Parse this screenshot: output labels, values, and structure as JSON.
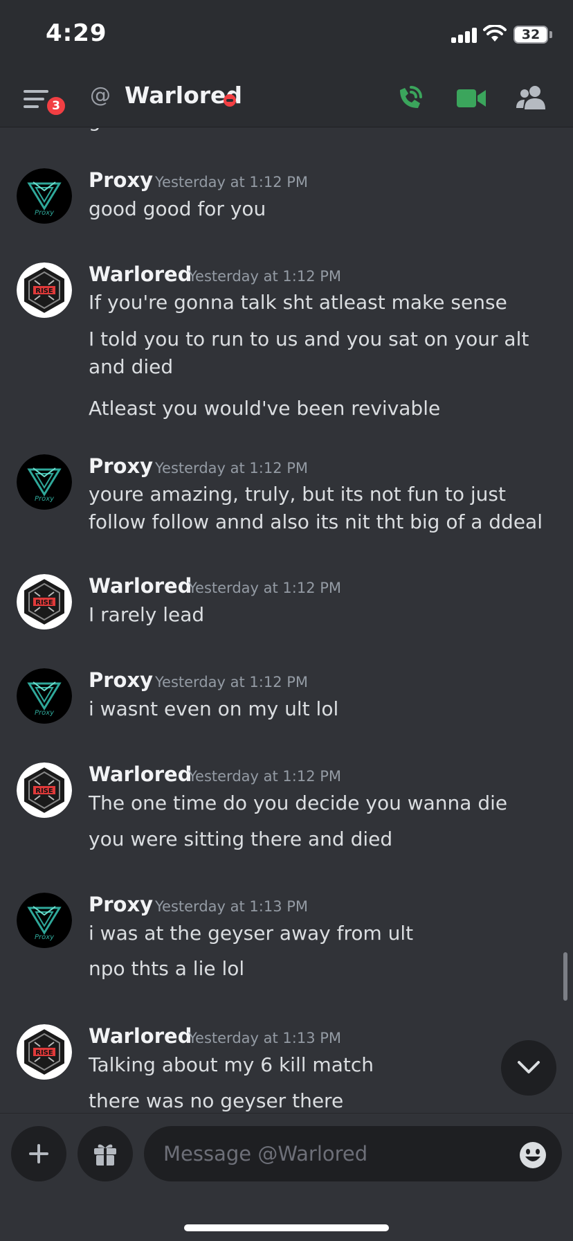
{
  "status_bar": {
    "time": "4:29",
    "battery": "32"
  },
  "header": {
    "unread_badge": "3",
    "at_symbol": "@",
    "channel_name": "Warlored"
  },
  "avatars": {
    "proxy_text": "Proxy",
    "warlored_text": "RISE"
  },
  "messages": [
    {
      "author": "Proxy",
      "timestamp": "Yesterday at 1:12 PM",
      "avatar": "proxy",
      "lines": [
        "good good for you"
      ]
    },
    {
      "author": "Warlored",
      "timestamp": "Yesterday at 1:12 PM",
      "avatar": "warlored",
      "lines": [
        "If you're gonna talk sht atleast make sense",
        "I told you to run to us and you sat on your alt and died",
        "Atleast you would've been revivable"
      ]
    },
    {
      "author": "Proxy",
      "timestamp": "Yesterday at 1:12 PM",
      "avatar": "proxy",
      "lines": [
        "youre amazing, truly, but its not fun to just follow follow annd also its nit tht big of a ddeal"
      ]
    },
    {
      "author": "Warlored",
      "timestamp": "Yesterday at 1:12 PM",
      "avatar": "warlored",
      "lines": [
        "I rarely lead"
      ]
    },
    {
      "author": "Proxy",
      "timestamp": "Yesterday at 1:12 PM",
      "avatar": "proxy",
      "lines": [
        "i wasnt even on my ult lol"
      ]
    },
    {
      "author": "Warlored",
      "timestamp": "Yesterday at 1:12 PM",
      "avatar": "warlored",
      "lines": [
        "The one time do you decide you wanna die",
        "you were sitting there and died"
      ]
    },
    {
      "author": "Proxy",
      "timestamp": "Yesterday at 1:13 PM",
      "avatar": "proxy",
      "lines": [
        "i was at the geyser away from ult",
        "npo thts a lie lol"
      ]
    },
    {
      "author": "Warlored",
      "timestamp": "Yesterday at 1:13 PM",
      "avatar": "warlored",
      "lines": [
        "Talking about my 6 kill match",
        "there was no geyser there"
      ]
    }
  ],
  "composer": {
    "placeholder": "Message @Warlored"
  },
  "icons": {
    "menu": "hamburger-menu-icon",
    "call": "phone-call-icon",
    "video": "video-camera-icon",
    "members": "members-icon",
    "add": "plus-icon",
    "gift": "gift-icon",
    "emoji": "emoji-icon",
    "jump": "chevron-down-icon"
  },
  "colors": {
    "background": "#313338",
    "header_bg": "#2b2d31",
    "accent_green": "#3ba55c",
    "badge_red": "#f23f43",
    "timestamp": "#949ba4",
    "username": "#f2f3f5"
  }
}
